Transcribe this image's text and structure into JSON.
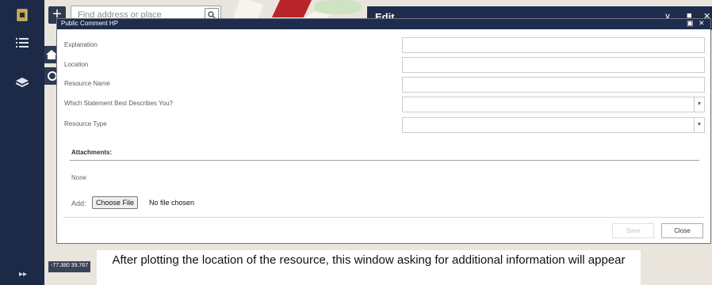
{
  "search": {
    "placeholder": "Find address or place"
  },
  "edit_panel": {
    "title": "Edit"
  },
  "dialog": {
    "title": "Public Comment HP",
    "fields": [
      {
        "label": "Explanation",
        "type": "text",
        "value": ""
      },
      {
        "label": "Location",
        "type": "text",
        "value": ""
      },
      {
        "label": "Resource Name",
        "type": "text",
        "value": ""
      },
      {
        "label": "Which Statement Best Describes You?",
        "type": "select",
        "value": ""
      },
      {
        "label": "Resource Type",
        "type": "select",
        "value": ""
      }
    ],
    "attachments": {
      "title": "Attachments:",
      "none_text": "None",
      "add_label": "Add:",
      "choose_file_label": "Choose File",
      "no_file_text": "No file chosen"
    },
    "buttons": {
      "save": "Save",
      "close": "Close"
    }
  },
  "map": {
    "coordinates": "-77.380 39.767"
  },
  "caption": "After plotting the location of the resource, this window asking for additional information will appear",
  "colors": {
    "sidebar": "#1c2a47",
    "header": "#1e2d4d",
    "map_red": "#b8262b"
  },
  "icons": {
    "sidebar": [
      "app-logo-icon",
      "list-icon",
      "layers-icon",
      "expand-icon"
    ],
    "map": [
      "zoom-in-icon",
      "search-icon",
      "home-icon",
      "locate-icon"
    ]
  }
}
